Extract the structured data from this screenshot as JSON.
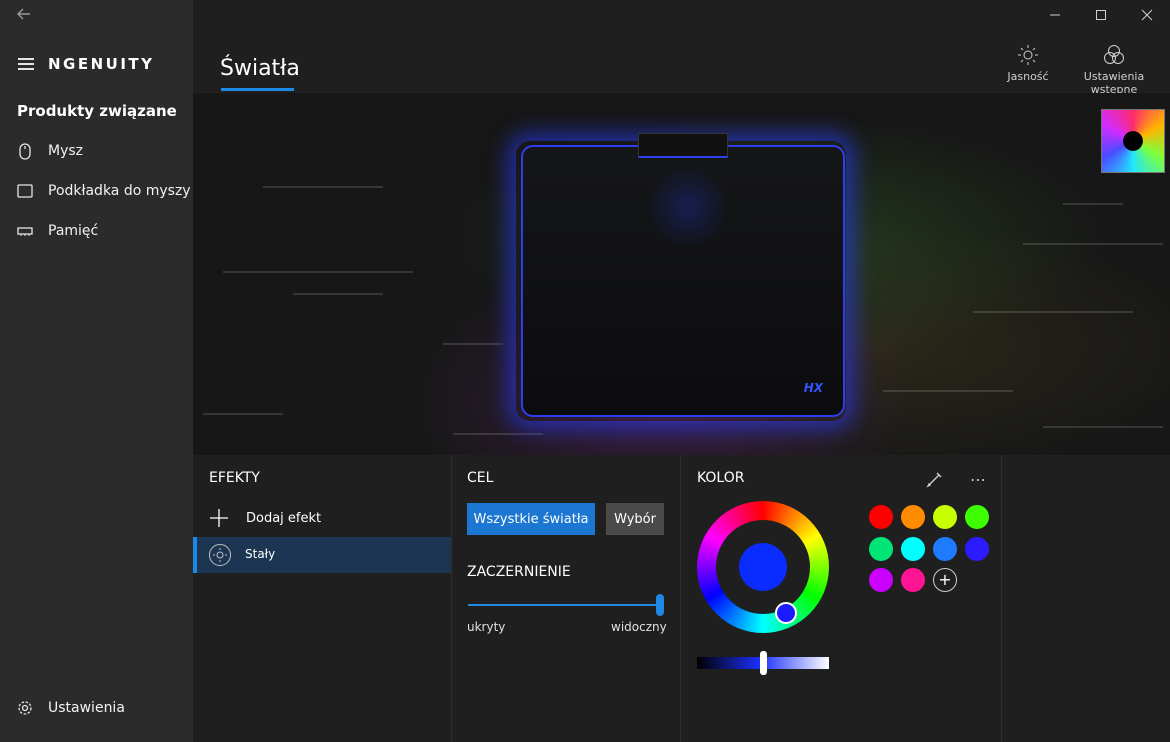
{
  "app": {
    "brand": "NGENUITY"
  },
  "sidebar": {
    "section_title": "Produkty związane",
    "items": [
      {
        "label": "Mysz",
        "icon": "mouse-icon"
      },
      {
        "label": "Podkładka do myszy",
        "icon": "mousepad-icon"
      },
      {
        "label": "Pamięć",
        "icon": "memory-icon"
      }
    ],
    "settings_label": "Ustawienia"
  },
  "header": {
    "title": "Światła",
    "actions": [
      {
        "label": "Jasność",
        "icon": "brightness-icon"
      },
      {
        "label": "Ustawienia wstępne",
        "icon": "presets-icon"
      }
    ]
  },
  "effects": {
    "title": "EFEKTY",
    "add_label": "Dodaj efekt",
    "items": [
      {
        "label": "Stały",
        "selected": true
      }
    ]
  },
  "target": {
    "title": "CEL",
    "all_lights_label": "Wszystkie światła",
    "selection_label": "Wybór",
    "fade_title": "ZACZERNIENIE",
    "min_label": "ukryty",
    "max_label": "widoczny",
    "fade_value": 1.0
  },
  "color": {
    "title": "KOLOR",
    "selected": "#0a2cff",
    "brightness_value": 0.5,
    "swatches": [
      "#ff0000",
      "#ff8c00",
      "#c8ff00",
      "#3dff00",
      "#00e676",
      "#00ffff",
      "#1e7bff",
      "#2d1bff",
      "#cc00ff",
      "#ff1493"
    ],
    "accent": "#1e88e5"
  }
}
